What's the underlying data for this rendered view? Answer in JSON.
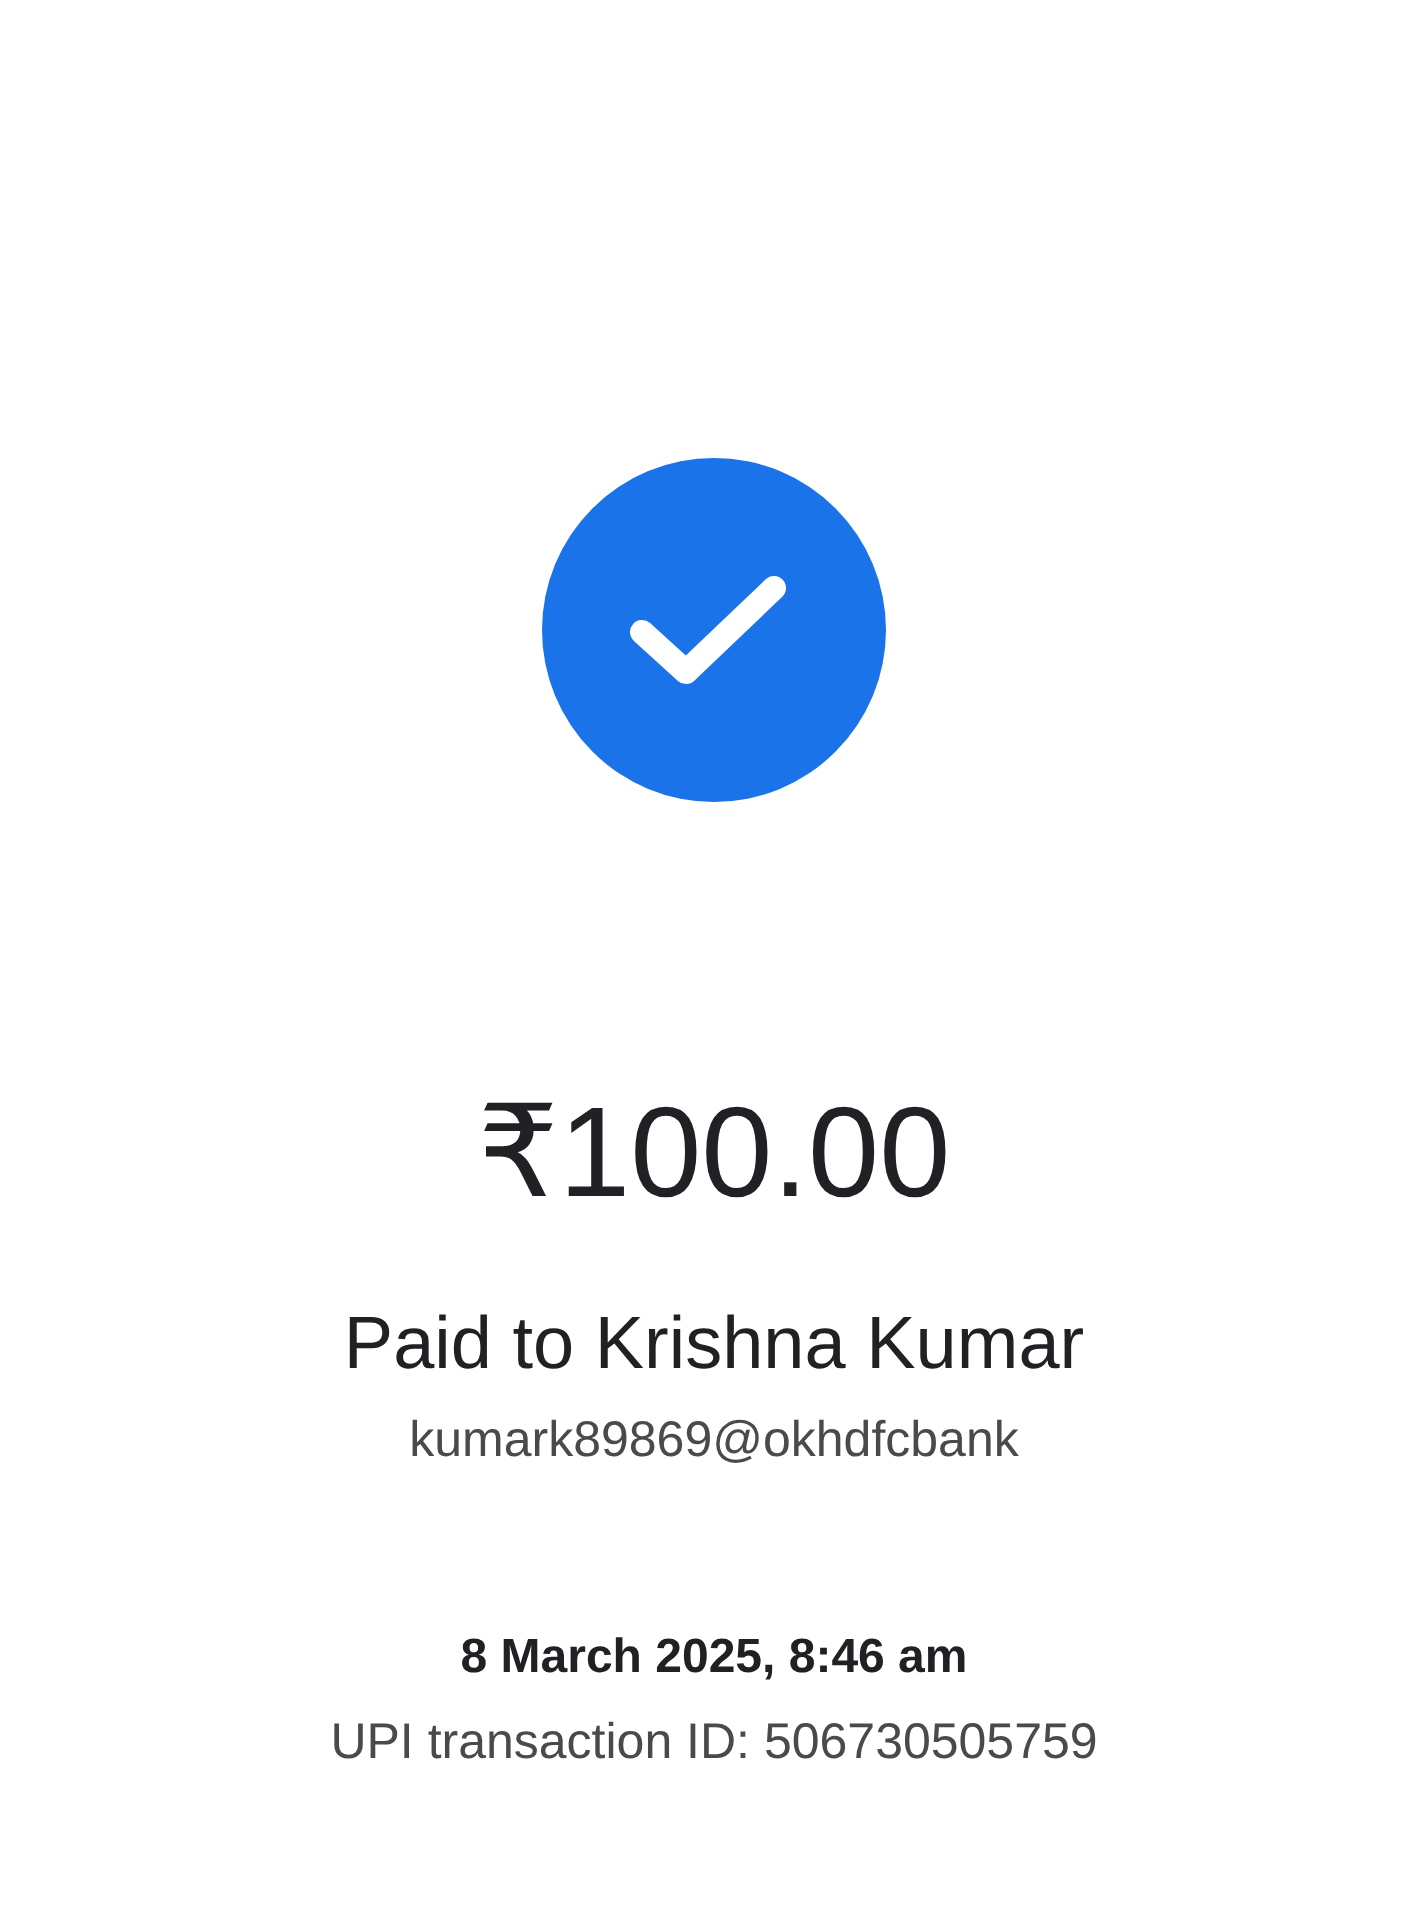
{
  "status": {
    "kind": "success"
  },
  "amount": "₹100.00",
  "payee": {
    "label": "Paid to Krishna Kumar",
    "upi_id": "kumark89869@okhdfcbank"
  },
  "transaction": {
    "datetime": "8 March 2025, 8:46 am",
    "id_line": "UPI transaction ID: 506730505759"
  }
}
